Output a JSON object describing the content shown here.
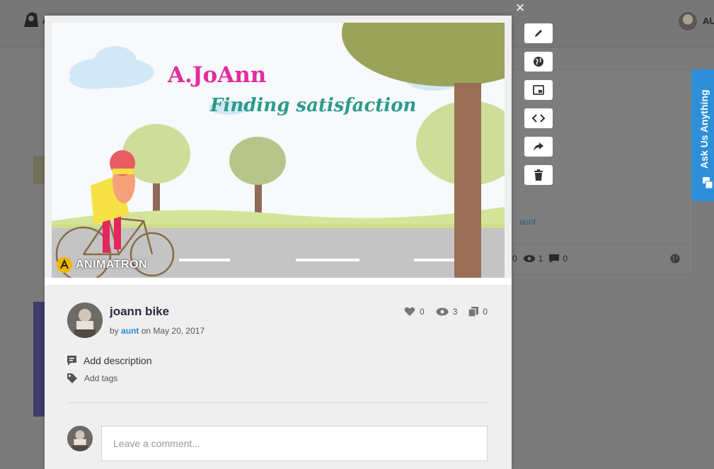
{
  "background": {
    "logo_text": "A",
    "user_initials": "AU",
    "panel_author": "aunt",
    "panel_stats": {
      "likes": "0",
      "views": "1",
      "comments": "0"
    }
  },
  "modal": {
    "close_label": "×",
    "preview": {
      "title": "A.JoAnn",
      "subtitle": "Finding satisfaction",
      "brand": "ANIMATRON"
    },
    "animation_title": "joann bike",
    "byline_by": "by",
    "author": "aunt",
    "byline_on": "on May 20, 2017",
    "stats": {
      "likes": "0",
      "views": "3",
      "copies": "0"
    },
    "add_description": "Add description",
    "add_tags": "Add tags",
    "comment_placeholder": "Leave a comment..."
  },
  "tools": [
    "pencil-icon",
    "globe-icon",
    "picture-in-picture-icon",
    "code-icon",
    "share-icon",
    "trash-icon"
  ],
  "ask_tab": {
    "label": "Ask Us Anything"
  },
  "colors": {
    "accent": "#2e8fd8",
    "title_pink": "#e22ca0",
    "subtitle_teal": "#2c9a8b",
    "link": "#2a8ad9"
  }
}
